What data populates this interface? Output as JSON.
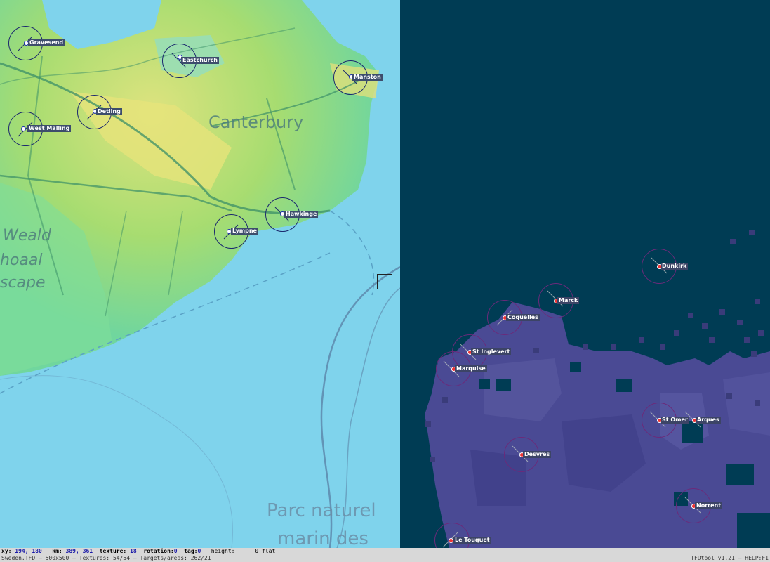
{
  "map_labels": {
    "canterbury": "Canterbury",
    "weald_1": "Weald",
    "weald_2": "hoaal",
    "weald_3": "scape",
    "parc_1": "Parc naturel",
    "parc_2": "marin des"
  },
  "airfields_gb": [
    "Gravesend",
    "Eastchurch",
    "Manston",
    "Detling",
    "West Malling",
    "Hawkinge",
    "Lympne"
  ],
  "airfields_fr": [
    "Dunkirk",
    "Marck",
    "Coquelles",
    "St Inglevert",
    "Marquise",
    "St Omer",
    "Arques",
    "Desvres",
    "Norrent",
    "Le Touquet"
  ],
  "status": {
    "xy_label": "xy:",
    "xy_value": "194, 180",
    "km_label": "km:",
    "km_value": "389, 361",
    "texture_label": "texture:",
    "texture_value": "18",
    "rotation_label": "rotation:",
    "rotation_value": "0",
    "tag_label": "tag:",
    "tag_value": "0",
    "height_label": "height:",
    "height_value": "0 flat",
    "file_info": "Sweden.TFD – 500x500 – Textures: 54/54 – Targets/areas: 262/21",
    "version": "TFDtool v1.21 – HELP:F1"
  },
  "colors": {
    "sea": "#7fd3ec",
    "dark_water": "#003c54",
    "terrain_purple": "#4a4a94",
    "land_green": "#8fd66a",
    "land_yellow": "#e0e07a"
  }
}
